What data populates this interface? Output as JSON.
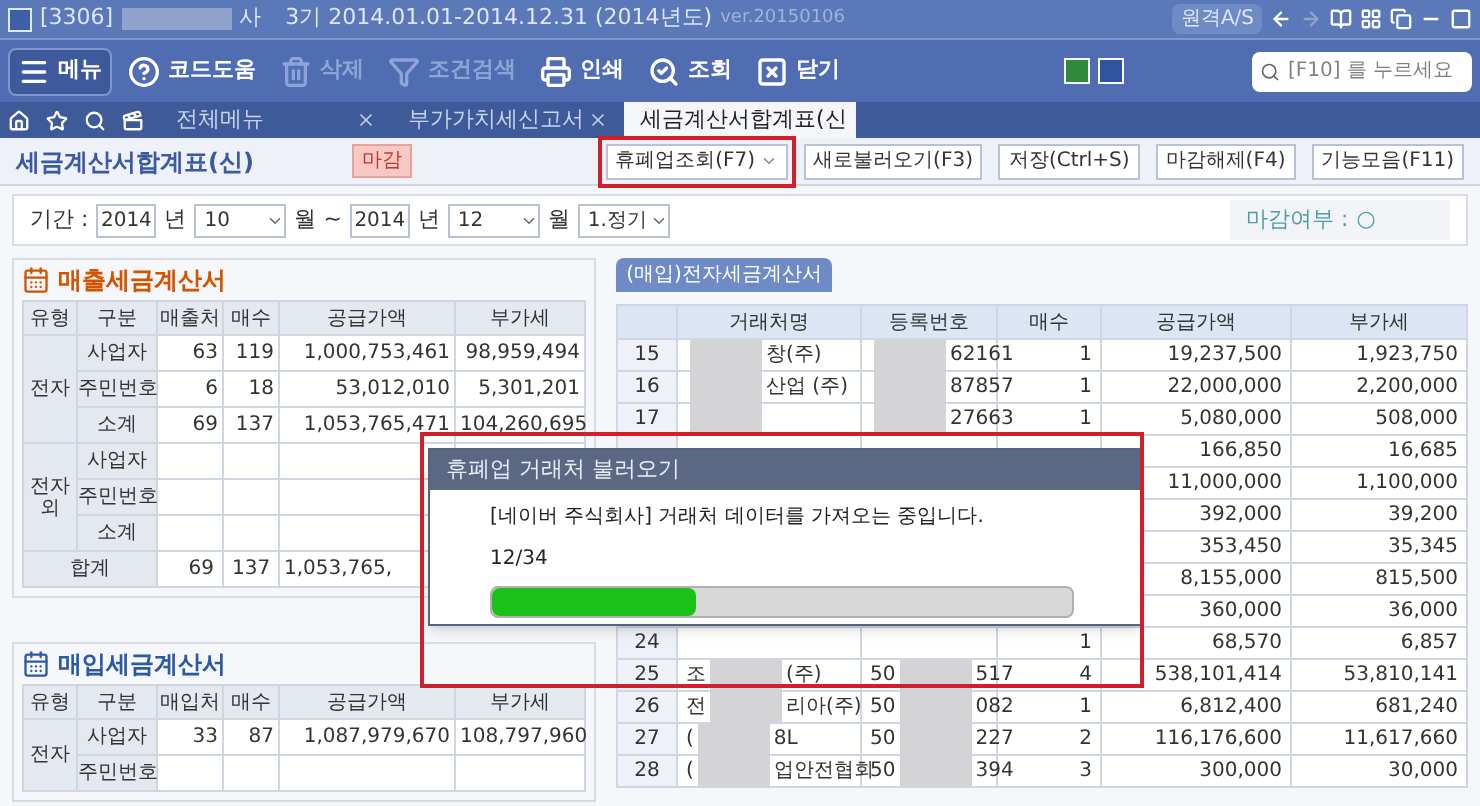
{
  "title_bar": {
    "code": "[3306]",
    "company_tail": "사",
    "period": "3기 2014.01.01-2014.12.31 (2014년도)",
    "version": "ver.20150106",
    "remote_button": "원격A/S"
  },
  "toolbar": {
    "items": [
      {
        "label": "메뉴",
        "disabled": false
      },
      {
        "label": "코드도움",
        "disabled": false
      },
      {
        "label": "삭제",
        "disabled": true
      },
      {
        "label": "조건검색",
        "disabled": true
      },
      {
        "label": "인쇄",
        "disabled": false
      },
      {
        "label": "조회",
        "disabled": false
      },
      {
        "label": "닫기",
        "disabled": false
      }
    ],
    "search": {
      "placeholder": "[F10] 를 누르세요"
    }
  },
  "tabs": [
    {
      "label": "전체메뉴",
      "selected": false
    },
    {
      "label": "부가가치세신고서",
      "selected": false
    },
    {
      "label": "세금계산서합계표(신",
      "selected": true
    }
  ],
  "page_header": {
    "title": "세금계산서합계표(신)",
    "badge": "마감",
    "buttons": [
      {
        "label": "휴폐업조회(F7)",
        "dropdown": true
      },
      {
        "label": "새로불러오기(F3)",
        "dropdown": false
      },
      {
        "label": "저장(Ctrl+S)",
        "dropdown": false
      },
      {
        "label": "마감해제(F4)",
        "dropdown": false
      },
      {
        "label": "기능모음(F11)",
        "dropdown": false
      }
    ]
  },
  "filter": {
    "label": "기간 :",
    "items": [
      {
        "kind": "field",
        "text": "2014"
      },
      {
        "kind": "text",
        "text": "년"
      },
      {
        "kind": "select",
        "text": "10"
      },
      {
        "kind": "text",
        "text": "월 ~"
      },
      {
        "kind": "field",
        "text": "2014"
      },
      {
        "kind": "text",
        "text": "년"
      },
      {
        "kind": "select",
        "text": "12"
      },
      {
        "kind": "text",
        "text": "월"
      },
      {
        "kind": "select",
        "text": "1.정기"
      }
    ],
    "status_label": "마감여부 :",
    "status_value": "○"
  },
  "sales": {
    "title": "매출세금계산서",
    "columns": [
      "유형",
      "구분",
      "매출처",
      "매수",
      "공급가액",
      "부가세"
    ],
    "groups": [
      {
        "label": "전자",
        "rows": [
          {
            "label": "사업자",
            "cells": [
              "63",
              "119",
              "1,000,753,461",
              "98,959,494"
            ]
          },
          {
            "label": "주민번호",
            "cells": [
              "6",
              "18",
              "53,012,010",
              "5,301,201"
            ]
          },
          {
            "label": "소계",
            "cells": [
              "69",
              "137",
              "1,053,765,471",
              "104,260,695"
            ]
          }
        ]
      },
      {
        "label": "전자외",
        "rows": [
          {
            "label": "사업자"
          },
          {
            "label": "주민번호"
          },
          {
            "label": "소계"
          }
        ]
      }
    ],
    "total": {
      "label": "합계",
      "cells": [
        "69",
        "137",
        "1,053,765,"
      ]
    }
  },
  "purchases": {
    "title": "매입세금계산서",
    "columns": [
      "유형",
      "구분",
      "매입처",
      "매수",
      "공급가액",
      "부가세"
    ],
    "groups": [
      {
        "label": "전자",
        "rows": [
          {
            "label": "사업자",
            "cells": [
              "33",
              "87",
              "1,087,979,670",
              "108,797,960"
            ]
          },
          {
            "label": "주민번호"
          }
        ]
      }
    ]
  },
  "detail": {
    "tab": "(매입)전자세금계산서",
    "columns": [
      "거래처명",
      "등록번호",
      "매수",
      "공급가액",
      "부가세"
    ],
    "rows": [
      {
        "no": "15",
        "name": {
          "after": "창(주)"
        },
        "reg": {
          "after": "62161"
        },
        "count": "1",
        "amount": "19,237,500",
        "vat": "1,923,750"
      },
      {
        "no": "16",
        "name": {
          "after": "산업 (주)"
        },
        "reg": {
          "after": "87857"
        },
        "count": "1",
        "amount": "22,000,000",
        "vat": "2,200,000"
      },
      {
        "no": "17",
        "name": {},
        "reg": {
          "after": "27663"
        },
        "count": "1",
        "amount": "5,080,000",
        "vat": "508,000"
      },
      {
        "amount": "166,850",
        "vat": "16,685"
      },
      {
        "amount": "11,000,000",
        "vat": "1,100,000"
      },
      {
        "amount": "392,000",
        "vat": "39,200"
      },
      {
        "amount": "353,450",
        "vat": "35,345"
      },
      {
        "amount": "8,155,000",
        "vat": "815,500"
      },
      {
        "amount": "360,000",
        "vat": "36,000"
      },
      {
        "no": "24",
        "count": "1",
        "amount": "68,570",
        "vat": "6,857"
      },
      {
        "no": "25",
        "name": {
          "before": "조",
          "after": "(주)"
        },
        "reg": {
          "before": "50",
          "after": "517"
        },
        "count": "4",
        "amount": "538,101,414",
        "vat": "53,810,141"
      },
      {
        "no": "26",
        "name": {
          "before": "전",
          "after": "리아(주)"
        },
        "reg": {
          "before": "50",
          "after": "082"
        },
        "count": "1",
        "amount": "6,812,400",
        "vat": "681,240"
      },
      {
        "no": "27",
        "name": {
          "before": "(",
          "after": "8L"
        },
        "reg": {
          "before": "50",
          "after": "227"
        },
        "count": "2",
        "amount": "116,176,600",
        "vat": "11,617,660"
      },
      {
        "no": "28",
        "name": {
          "before": "(",
          "after": "업안전협회"
        },
        "reg": {
          "before": "50",
          "after": "394"
        },
        "count": "3",
        "amount": "300,000",
        "vat": "30,000"
      }
    ]
  },
  "dialog": {
    "title": "휴폐업 거래처 불러오기",
    "message": "[네이버 주식회사] 거래처 데이터를 가져오는 중입니다.",
    "count": "12/34",
    "level": 0.35
  }
}
